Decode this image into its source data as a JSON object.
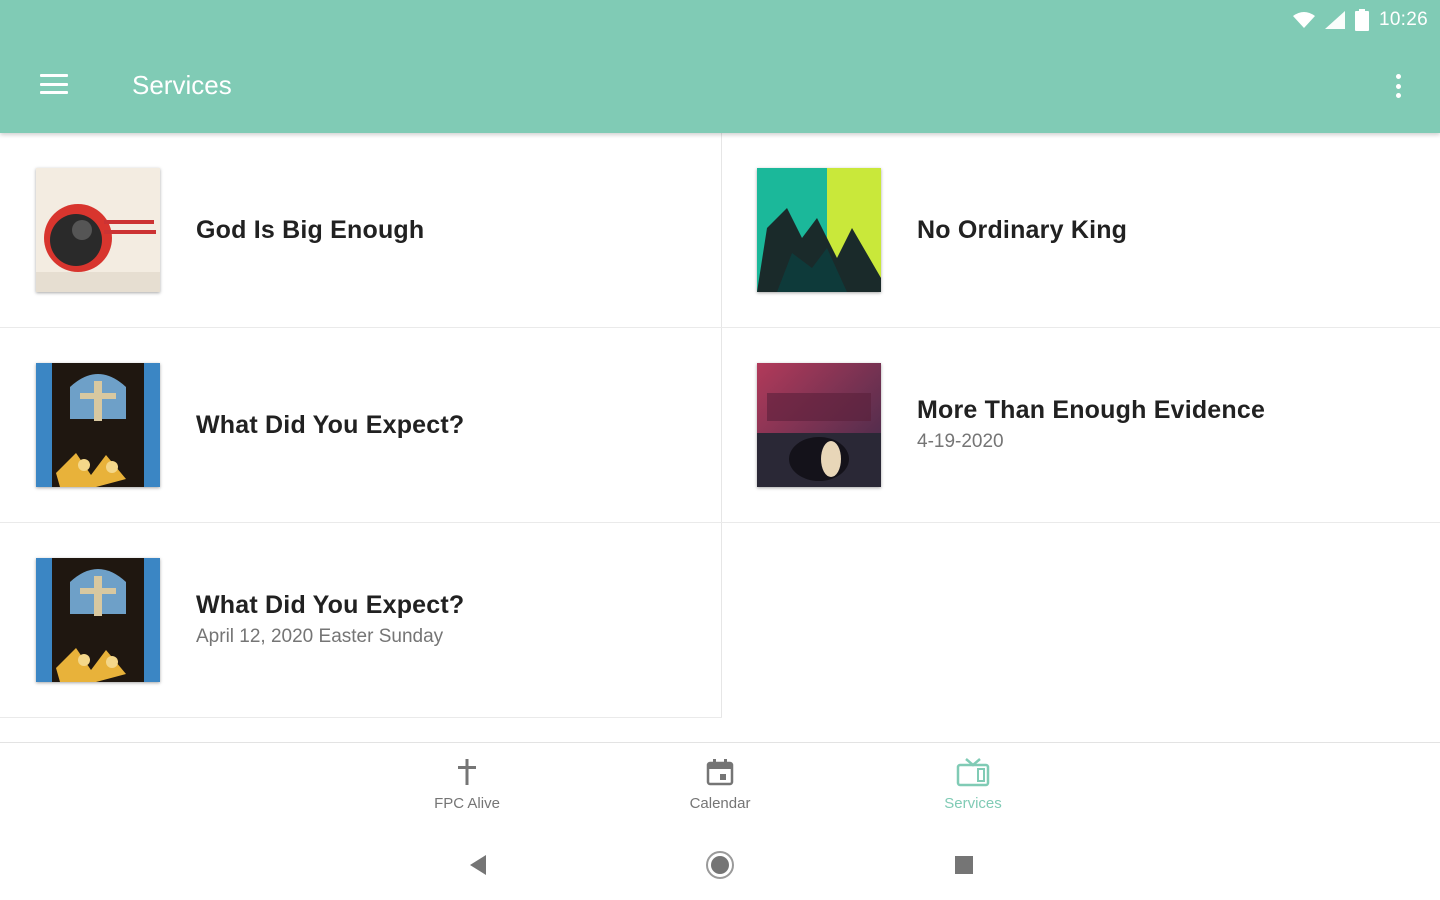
{
  "status_bar": {
    "time": "10:26"
  },
  "app_bar": {
    "title": "Services"
  },
  "services": [
    {
      "title": "God Is Big Enough",
      "subtitle": "",
      "thumb_text": "God Is Big Enough"
    },
    {
      "title": "No Ordinary King",
      "subtitle": "",
      "thumb_text": "No Ordinary King"
    },
    {
      "title": "What Did You Expect?",
      "subtitle": "",
      "thumb_text": ""
    },
    {
      "title": "More Than Enough Evidence",
      "subtitle": "4-19-2020",
      "thumb_text": "More Than Enough Evidence"
    },
    {
      "title": "What Did You Expect?",
      "subtitle": "April 12, 2020 Easter Sunday",
      "thumb_text": ""
    }
  ],
  "bottom_nav": [
    {
      "label": "FPC Alive",
      "icon": "cross-icon",
      "active": false
    },
    {
      "label": "Calendar",
      "icon": "calendar-icon",
      "active": false
    },
    {
      "label": "Services",
      "icon": "tv-icon",
      "active": true
    }
  ],
  "colors": {
    "accent": "#80cbb5",
    "text_primary": "#212121",
    "text_secondary": "#757575"
  }
}
